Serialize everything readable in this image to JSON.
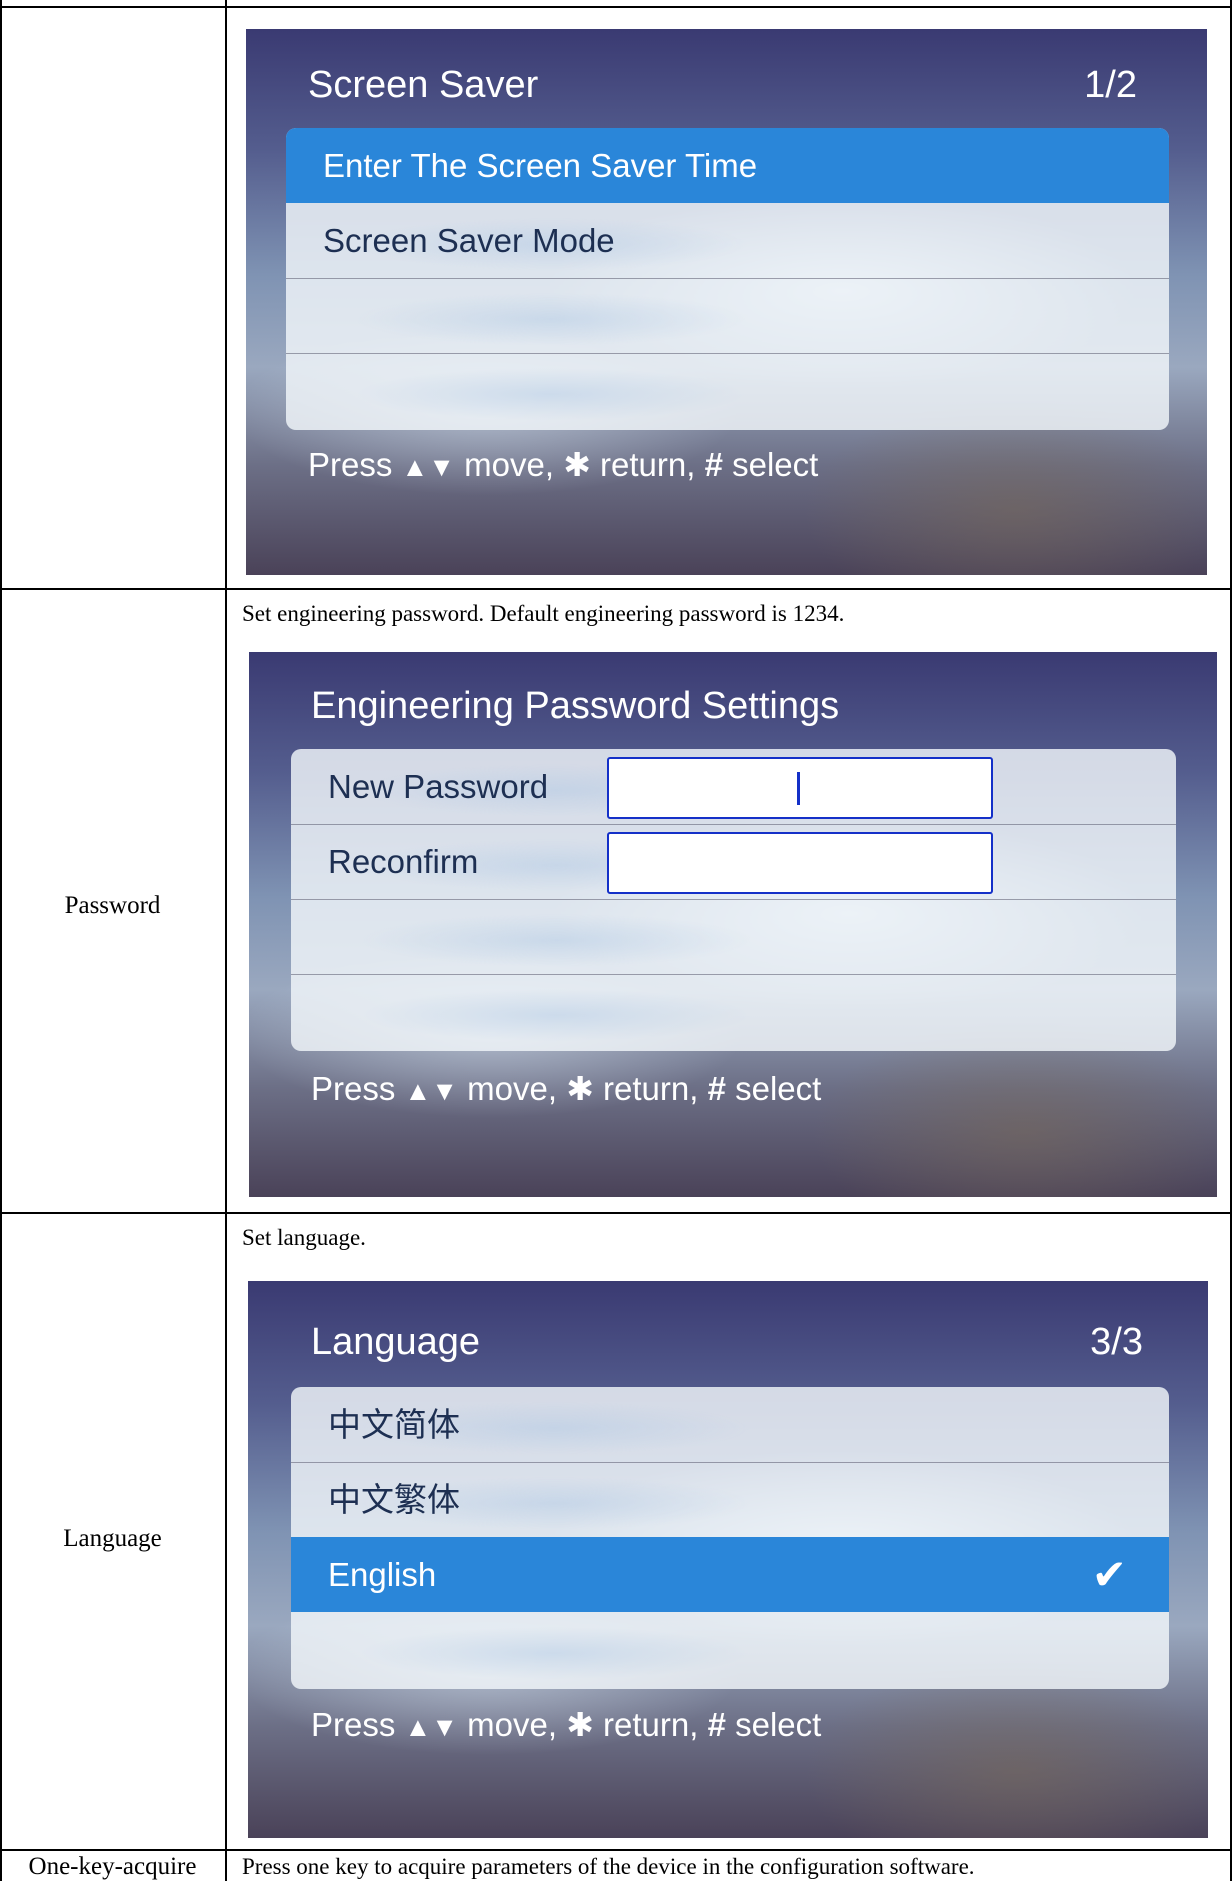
{
  "rows": [
    {
      "label": "",
      "description": "",
      "screen": {
        "title": "Screen Saver",
        "page": "1/2",
        "items": [
          "Enter The Screen Saver Time",
          "Screen Saver Mode",
          "",
          ""
        ],
        "selected_index": 0
      }
    },
    {
      "label": "Password",
      "description": "Set engineering password. Default engineering password is 1234.",
      "screen": {
        "title": "Engineering Password Settings",
        "fields": [
          {
            "label": "New Password",
            "value": ""
          },
          {
            "label": "Reconfirm",
            "value": ""
          }
        ],
        "items": [
          "",
          ""
        ]
      }
    },
    {
      "label": "Language",
      "description": "Set language.",
      "screen": {
        "title": "Language",
        "page": "3/3",
        "items": [
          "中文简体",
          "中文繁体",
          "English",
          ""
        ],
        "selected_index": 2,
        "checked_index": 2
      }
    },
    {
      "label": "One-key-acquire",
      "description": "Press one key to acquire parameters of the device in the configuration software."
    }
  ],
  "footer": {
    "press": "Press",
    "move_glyph": "▲▼",
    "move": "move,",
    "return_glyph": "✱",
    "return": "return,",
    "select_glyph": "#",
    "select": "select"
  },
  "icons": {
    "check": "✔"
  },
  "colors": {
    "selected_row": "#2a86d9",
    "field_border": "#1430c8",
    "menu_text": "#1d2f52"
  }
}
